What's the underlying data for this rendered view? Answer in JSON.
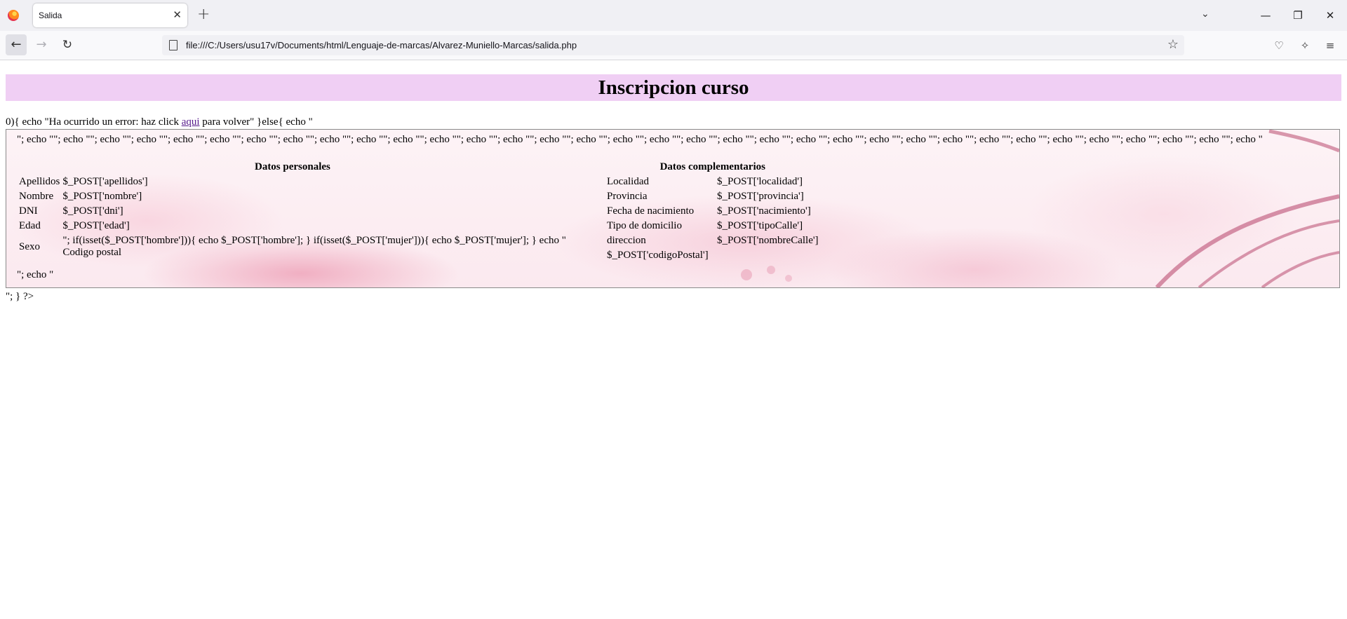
{
  "browser": {
    "tab_title": "Salida",
    "tab_close": "✕",
    "new_tab": "+",
    "url": "file:///C:/Users/usu17v/Documents/html/Lenguaje-de-marcas/Alvarez-Muniello-Marcas/salida.php",
    "icons": {
      "back": "←",
      "forward": "→",
      "reload": "↻",
      "star": "☆",
      "pocket": "♡",
      "extensions": "✧",
      "menu": "≡",
      "tab_list": "⌄",
      "minimize": "—",
      "restore": "❐",
      "close": "✕"
    }
  },
  "page": {
    "heading": "Inscripcion curso",
    "error_line": {
      "before": "0){ echo \"Ha ocurrido un error: haz click ",
      "link": "aqui",
      "after": " para volver\" }else{ echo \""
    },
    "echo_text": "\"; echo \"\"; echo \"\"; echo \"\"; echo \"\"; echo \"\"; echo \"\"; echo \"\"; echo \"\"; echo \"\"; echo \"\"; echo \"\"; echo \"\"; echo \"\"; echo \"\"; echo \"\"; echo \"\"; echo \"\"; echo \"\"; echo \"\"; echo \"\"; echo \"\"; echo \"\"; echo \"\"; echo \"\"; echo \"\"; echo \"\"; echo \"\"; echo \"\"; echo \"\"; echo \"\"; echo \"\"; echo \"\"; echo \"\"; echo \"",
    "personal": {
      "title": "Datos personales",
      "rows": [
        {
          "label": "Apellidos",
          "value": "$_POST['apellidos']"
        },
        {
          "label": "Nombre",
          "value": "$_POST['nombre']"
        },
        {
          "label": "DNI",
          "value": "$_POST['dni']"
        },
        {
          "label": "Edad",
          "value": "$_POST['edad']"
        }
      ],
      "sexo_label": "Sexo",
      "sexo_code": "\"; if(isset($_POST['hombre'])){ echo $_POST['hombre']; } if(isset($_POST['mujer'])){ echo $_POST['mujer']; } echo \"",
      "codigo_label": "Codigo postal"
    },
    "complementary": {
      "title": "Datos complementarios",
      "rows": [
        {
          "label": "Localidad",
          "value": "$_POST['localidad']"
        },
        {
          "label": "Provincia",
          "value": "$_POST['provincia']"
        },
        {
          "label": "Fecha de nacimiento",
          "value": "$_POST['nacimiento']"
        },
        {
          "label": "Tipo de domicilio",
          "value": "$_POST['tipoCalle']"
        },
        {
          "label": "direccion",
          "value": "$_POST['nombreCalle']"
        },
        {
          "label": "",
          "value": "$_POST['codigoPostal']"
        }
      ]
    },
    "panel_end": "\"; echo \"",
    "footer_line": "\"; } ?>"
  }
}
